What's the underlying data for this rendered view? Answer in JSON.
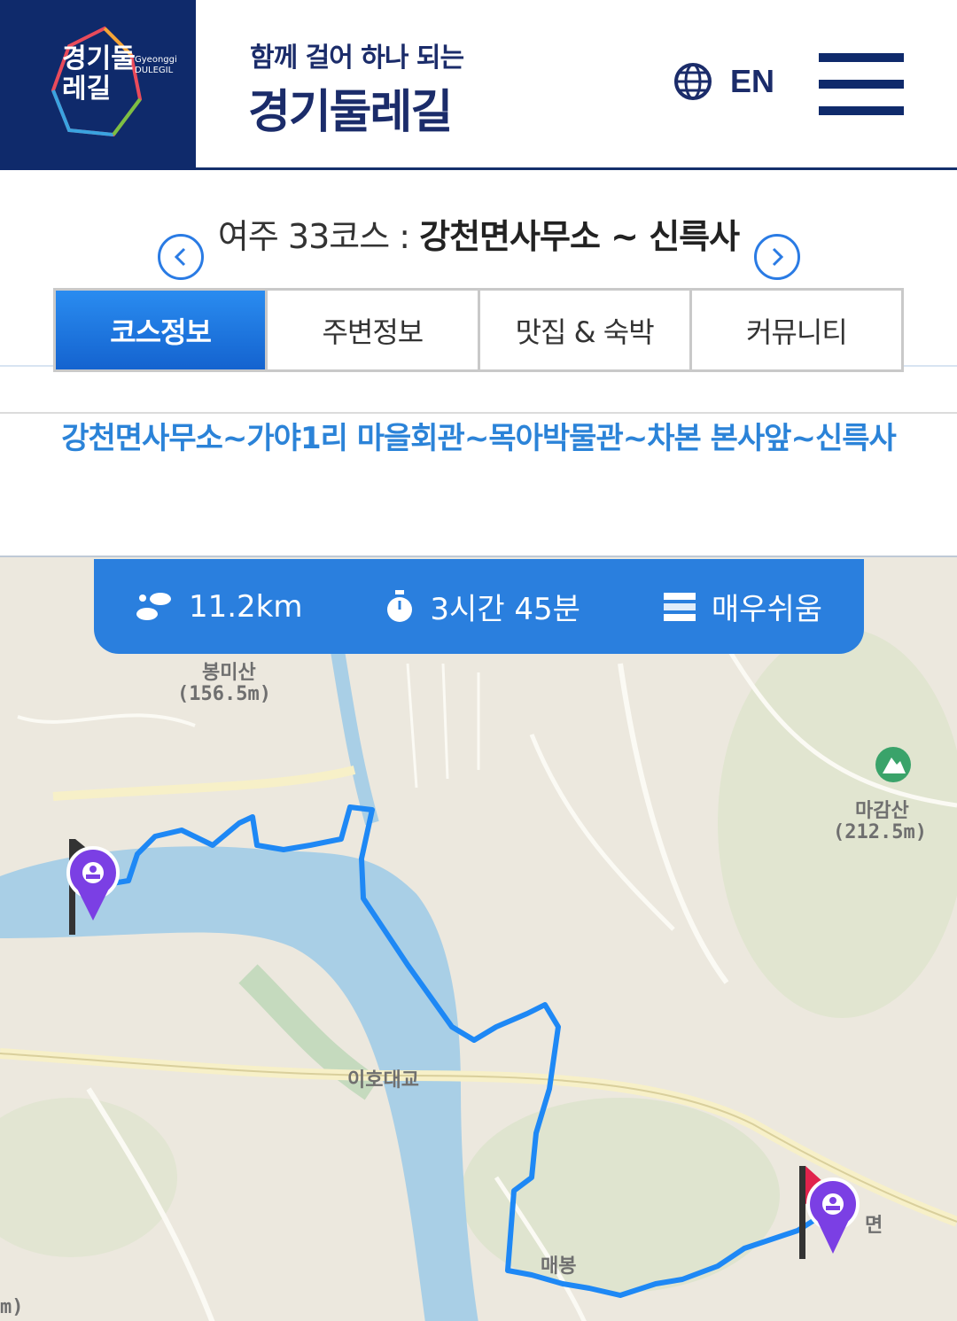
{
  "header": {
    "logo_text": "경기둘레길",
    "logo_en": "Gyeonggi DULEGIL",
    "slogan": "함께 걸어 하나 되는",
    "brand": "경기둘레길",
    "lang_label": "EN",
    "icons": [
      "globe-icon",
      "hamburger-menu-icon"
    ]
  },
  "course": {
    "prefix": "여주 33코스 : ",
    "name": "강천면사무소 ~ 신륵사"
  },
  "tabs": [
    {
      "label": "코스정보",
      "active": true
    },
    {
      "label": "주변정보",
      "active": false
    },
    {
      "label": "맛집 & 숙박",
      "active": false
    },
    {
      "label": "커뮤니티",
      "active": false
    }
  ],
  "route_text": "강천면사무소~가야1리 마을회관~목아박물관~차본 본사앞~신륵사",
  "stats": {
    "distance": "11.2km",
    "time": "3시간 45분",
    "difficulty": "매우쉬움"
  },
  "map": {
    "labels": {
      "mountain1": "봉미산",
      "mountain1_height": "(156.5m)",
      "mountain2": "마감산",
      "mountain2_height": "(212.5m)",
      "bridge": "이호대교",
      "village": "매봉",
      "edge_left": "m)",
      "edge_right": "면"
    },
    "colors": {
      "route": "#1e88f5",
      "river": "#a9cfe6",
      "land": "#ece8de",
      "marker": "#7b3fe4"
    }
  }
}
